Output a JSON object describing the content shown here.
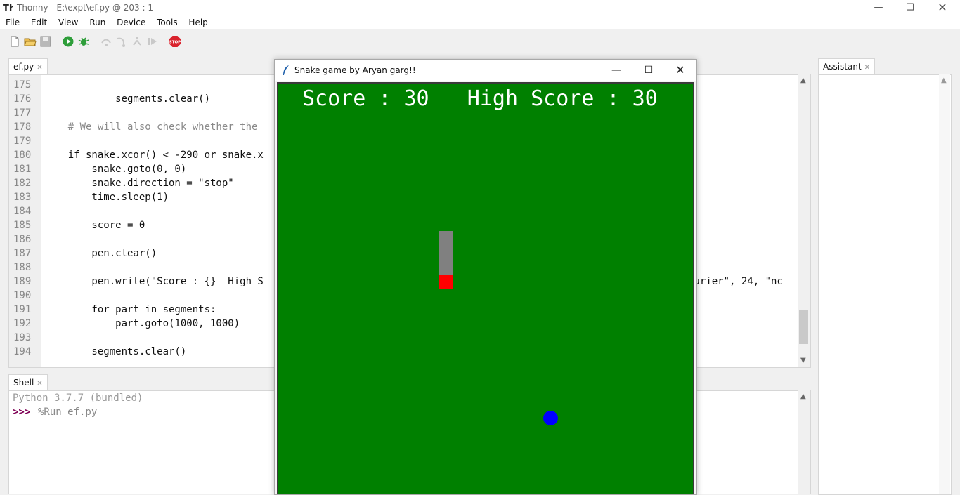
{
  "window": {
    "title": "Thonny  -  E:\\expt\\ef.py  @  203 : 1",
    "min_icon": "minimize-icon",
    "max_icon": "restore-icon",
    "close_icon": "close-icon"
  },
  "menu": [
    "File",
    "Edit",
    "View",
    "Run",
    "Device",
    "Tools",
    "Help"
  ],
  "toolbar": {
    "icons": [
      "new-file-icon",
      "open-file-icon",
      "save-icon",
      "run-icon",
      "debug-icon",
      "step-over-icon",
      "step-into-icon",
      "step-out-icon",
      "resume-icon",
      "stop-icon"
    ],
    "stop_label": "STOP"
  },
  "editor": {
    "tab_label": "ef.py",
    "lines": [
      {
        "n": "175",
        "code": ""
      },
      {
        "n": "176",
        "code": "            segments.clear()"
      },
      {
        "n": "177",
        "code": ""
      },
      {
        "n": "178",
        "code": "    # We will also check whether the"
      },
      {
        "n": "179",
        "code": ""
      },
      {
        "n": "180",
        "code": "    if snake.xcor() < -290 or snake.x"
      },
      {
        "n": "181",
        "code": "        snake.goto(0, 0)"
      },
      {
        "n": "182",
        "code": "        snake.direction = \"stop\""
      },
      {
        "n": "183",
        "code": "        time.sleep(1)"
      },
      {
        "n": "184",
        "code": ""
      },
      {
        "n": "185",
        "code": "        score = 0"
      },
      {
        "n": "186",
        "code": ""
      },
      {
        "n": "187",
        "code": "        pen.clear()"
      },
      {
        "n": "188",
        "code": ""
      },
      {
        "n": "189",
        "code": "        pen.write(\"Score : {}  High S"
      },
      {
        "n": "190",
        "code": ""
      },
      {
        "n": "191",
        "code": "        for part in segments:"
      },
      {
        "n": "192",
        "code": "            part.goto(1000, 1000)"
      },
      {
        "n": "193",
        "code": ""
      },
      {
        "n": "194",
        "code": "        segments.clear()"
      }
    ],
    "line189_tail": "ourier\", 24, \"nc"
  },
  "shell": {
    "tab_label": "Shell",
    "lines": [
      "Python 3.7.7 (bundled)",
      "%Run ef.py"
    ],
    "prompt": ">>>"
  },
  "assistant": {
    "tab_label": "Assistant"
  },
  "snake_window": {
    "title": "Snake game by Aryan garg!!",
    "score_text": "Score : 30   High Score : 30",
    "colors": {
      "background": "#008000",
      "snake_body": "#808080",
      "snake_head": "#ff0000",
      "food": "#0000ff"
    }
  }
}
